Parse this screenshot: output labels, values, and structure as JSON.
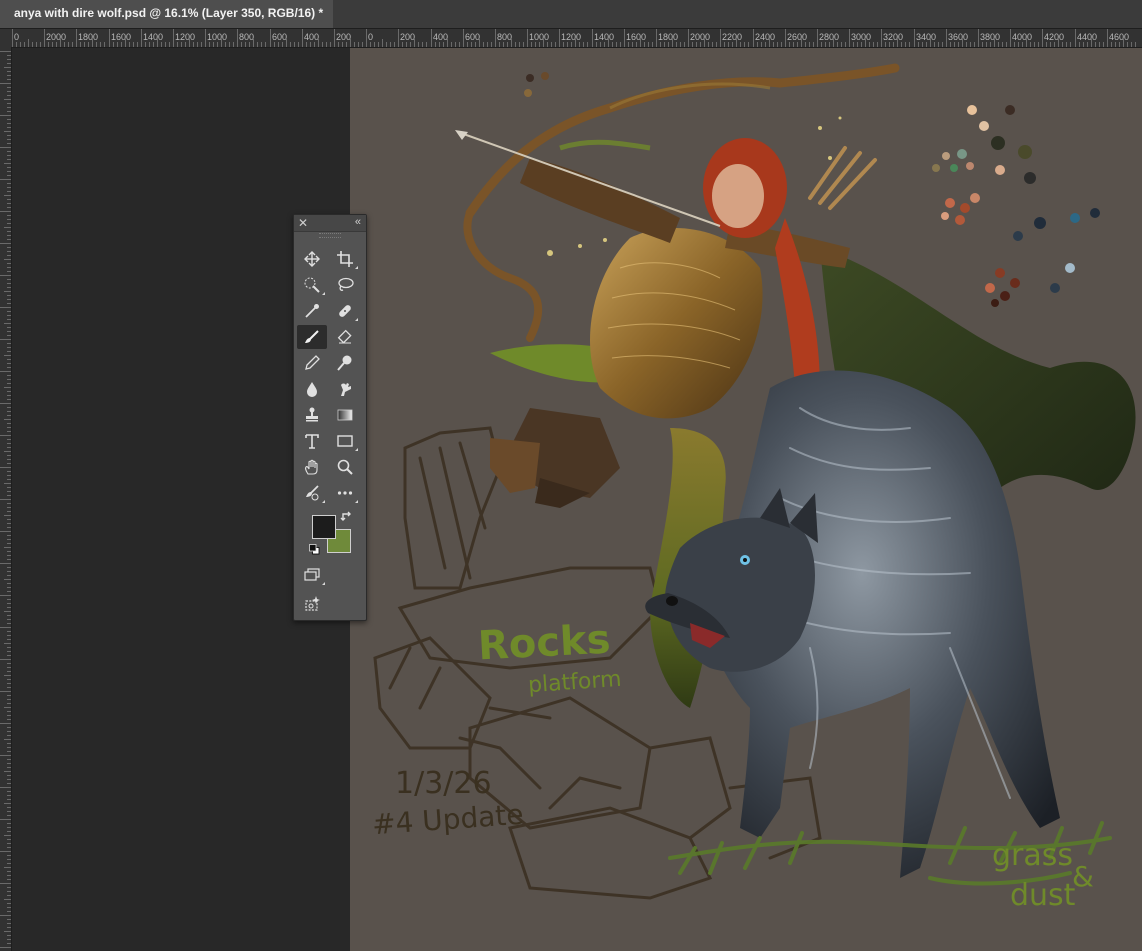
{
  "document": {
    "tab_title": "anya with dire wolf.psd @ 16.1% (Layer 350, RGB/16) *"
  },
  "rulers": {
    "unit": "px",
    "labels": [
      "0",
      "2000",
      "1800",
      "1600",
      "1400",
      "1200",
      "1000",
      "800",
      "600",
      "400",
      "200",
      "0",
      "200",
      "400",
      "600",
      "800",
      "1000",
      "1200",
      "1400",
      "1600",
      "1800",
      "2000",
      "2200",
      "2400",
      "2600",
      "2800",
      "3000",
      "3200",
      "3400",
      "3600",
      "3800",
      "4000",
      "4200",
      "4400",
      "4600"
    ]
  },
  "canvas": {
    "background_color": "#59524c",
    "annotations": {
      "rocks": "Rocks",
      "platform": "platform",
      "date": "1/3/26",
      "update": "#4 Update",
      "grass": "grass",
      "ampersand": "&",
      "dust": "dust"
    }
  },
  "toolbar": {
    "foreground_color": "#1c1c1c",
    "background_color": "#6f8a3a",
    "tools": [
      {
        "name": "move-tool",
        "icon": "move-icon"
      },
      {
        "name": "crop-tool",
        "icon": "crop-icon"
      },
      {
        "name": "quick-selection-tool",
        "icon": "quick-selection-icon"
      },
      {
        "name": "lasso-tool",
        "icon": "lasso-icon"
      },
      {
        "name": "eyedropper-tool",
        "icon": "eyedropper-icon"
      },
      {
        "name": "healing-brush-tool",
        "icon": "bandage-icon"
      },
      {
        "name": "brush-tool",
        "icon": "brush-icon",
        "active": true
      },
      {
        "name": "eraser-tool",
        "icon": "eraser-icon"
      },
      {
        "name": "pencil-tool",
        "icon": "pencil-icon"
      },
      {
        "name": "dodge-tool",
        "icon": "dodge-icon"
      },
      {
        "name": "blur-tool",
        "icon": "drop-icon"
      },
      {
        "name": "smudge-tool",
        "icon": "smudge-icon"
      },
      {
        "name": "clone-stamp-tool",
        "icon": "stamp-icon"
      },
      {
        "name": "gradient-tool",
        "icon": "gradient-icon"
      },
      {
        "name": "type-tool",
        "icon": "type-icon"
      },
      {
        "name": "rectangle-tool",
        "icon": "rectangle-icon"
      },
      {
        "name": "hand-tool",
        "icon": "hand-icon"
      },
      {
        "name": "zoom-tool",
        "icon": "zoom-icon"
      },
      {
        "name": "mixer-brush-tool",
        "icon": "mixer-brush-icon"
      },
      {
        "name": "more-tools",
        "icon": "ellipsis-icon"
      },
      {
        "name": "screen-mode",
        "icon": "screen-mode-icon"
      },
      {
        "name": "generative-fill",
        "icon": "generative-icon"
      }
    ]
  }
}
